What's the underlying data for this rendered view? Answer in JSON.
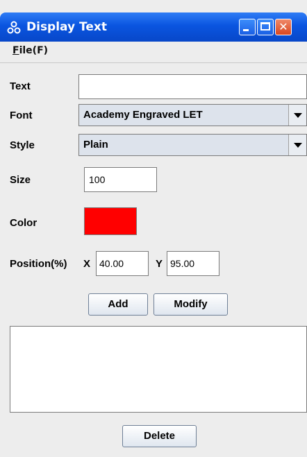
{
  "window": {
    "title": "Display Text",
    "app_icon": "app-link-icon",
    "close_glyph": "✕"
  },
  "menu": {
    "file_mnemonic": "F",
    "file_rest": "ile(F)"
  },
  "form": {
    "text_label": "Text",
    "text_value": "",
    "font_label": "Font",
    "font_value": "Academy Engraved LET",
    "style_label": "Style",
    "style_value": "Plain",
    "size_label": "Size",
    "size_value": "100",
    "color_label": "Color",
    "color_value": "#ff0000",
    "position_label": "Position(%)",
    "x_label": "X",
    "x_value": "40.00",
    "y_label": "Y",
    "y_value": "95.00"
  },
  "buttons": {
    "add": "Add",
    "modify": "Modify",
    "delete": "Delete"
  }
}
